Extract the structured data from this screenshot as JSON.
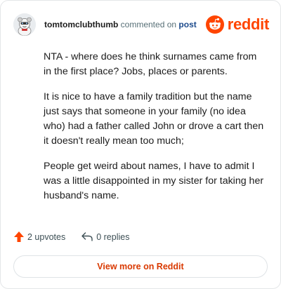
{
  "comment": {
    "username": "tomtomclubthumb",
    "action_text": "commented on",
    "target_link": "post",
    "paragraphs": [
      "NTA - where does he think surnames came from in the first place? Jobs, places or parents.",
      "It is nice to have a family tradition but the name just says that someone in your family (no idea who) had a father called John or drove a cart then it doesn't really mean too much;",
      "People get weird about names, I have to admit I was a little disappointed in my sister for taking her husband's name."
    ]
  },
  "brand": {
    "wordmark": "reddit",
    "color": "#ff4500"
  },
  "actions": {
    "upvotes_label": "2 upvotes",
    "replies_label": "0 replies"
  },
  "view_more_label": "View more on Reddit",
  "icons": {
    "avatar": "snoo-avatar-icon",
    "brand": "reddit-logo-icon",
    "upvote": "upvote-arrow-icon",
    "reply": "reply-arrow-icon"
  },
  "colors": {
    "accent": "#ff4500",
    "link": "#1c4a8c",
    "button_text": "#d93900",
    "text": "#1c1c1c",
    "muted": "#576f76"
  }
}
